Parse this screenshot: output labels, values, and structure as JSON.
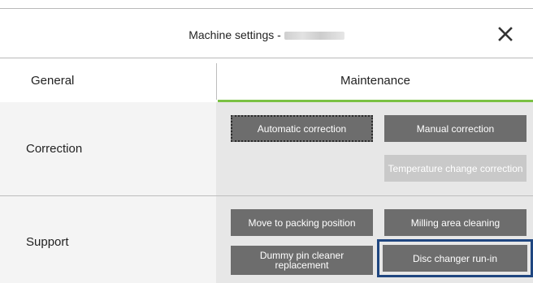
{
  "window": {
    "title_prefix": "Machine settings -",
    "close_icon": "close-icon"
  },
  "tabs": [
    {
      "label": "General",
      "active": false
    },
    {
      "label": "Maintenance",
      "active": true
    }
  ],
  "colors": {
    "accent": "#7ac143",
    "button": "#6d6d6d",
    "button_disabled": "#c9c9c9",
    "highlight": "#1f4680"
  },
  "sections": {
    "correction": {
      "label": "Correction",
      "buttons": {
        "automatic": "Automatic correction",
        "manual": "Manual correction",
        "temperature": "Temperature change correction"
      }
    },
    "support": {
      "label": "Support",
      "buttons": {
        "move_packing": "Move to packing position",
        "milling_cleaning": "Milling area cleaning",
        "dummy_pin_line1": "Dummy pin cleaner",
        "dummy_pin_line2": "replacement",
        "disc_changer": "Disc changer run-in"
      }
    }
  }
}
